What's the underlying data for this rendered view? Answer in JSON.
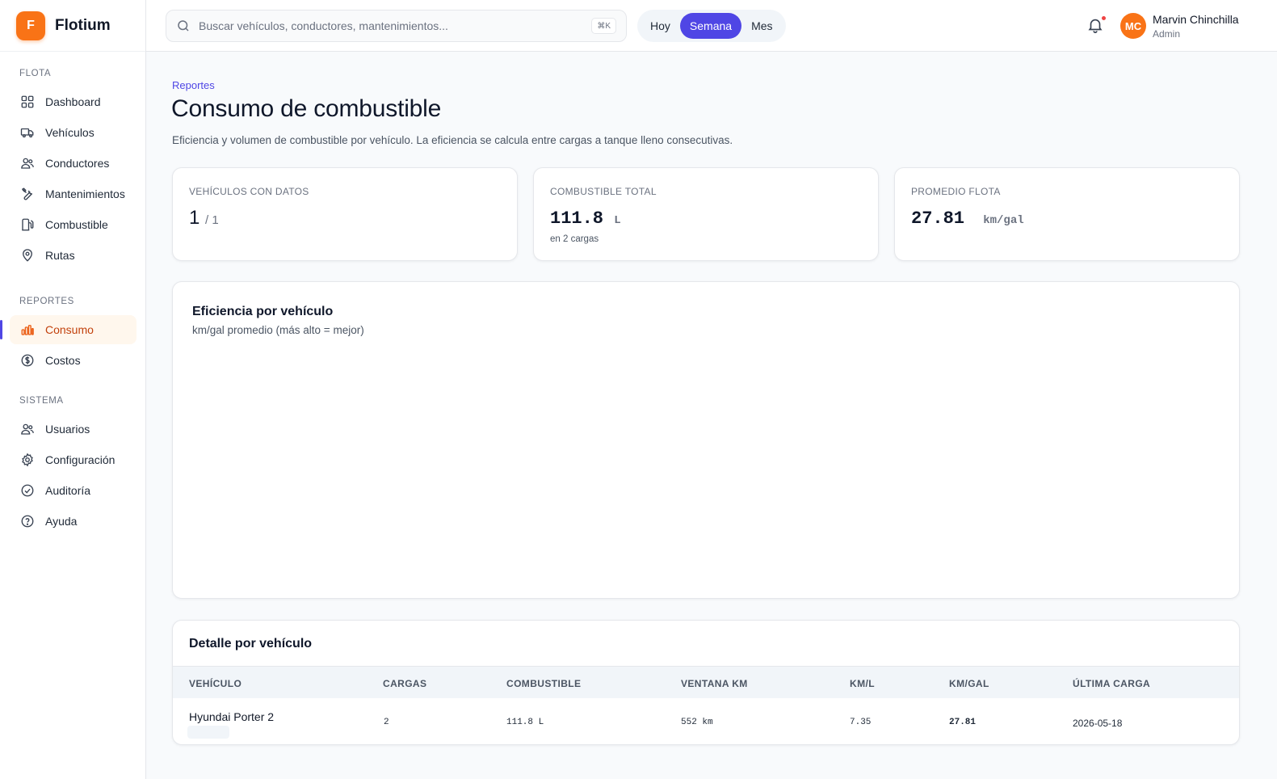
{
  "app": {
    "logo_letter": "F",
    "name": "Flotium"
  },
  "sidebar": {
    "sections": [
      {
        "label": "FLOTA",
        "items": [
          {
            "label": "Dashboard",
            "icon": "grid-icon"
          },
          {
            "label": "Vehículos",
            "icon": "truck-icon"
          },
          {
            "label": "Conductores",
            "icon": "users-icon"
          },
          {
            "label": "Mantenimientos",
            "icon": "wrench-icon"
          },
          {
            "label": "Combustible",
            "icon": "fuel-icon"
          },
          {
            "label": "Rutas",
            "icon": "map-pin-icon"
          }
        ]
      },
      {
        "label": "REPORTES",
        "items": [
          {
            "label": "Consumo",
            "icon": "bar-chart-icon",
            "active": true
          },
          {
            "label": "Costos",
            "icon": "dollar-circle-icon"
          }
        ]
      },
      {
        "label": "SISTEMA",
        "items": [
          {
            "label": "Usuarios",
            "icon": "users-icon"
          },
          {
            "label": "Configuración",
            "icon": "gear-icon"
          },
          {
            "label": "Auditoría",
            "icon": "check-circle-icon"
          },
          {
            "label": "Ayuda",
            "icon": "help-circle-icon"
          }
        ]
      }
    ]
  },
  "topbar": {
    "search_placeholder": "Buscar vehículos, conductores, mantenimientos...",
    "search_shortcut": "⌘K",
    "periods": [
      "Hoy",
      "Semana",
      "Mes"
    ],
    "active_period": "Semana",
    "user": {
      "initials": "MC",
      "name": "Marvin Chinchilla",
      "role": "Admin"
    }
  },
  "page": {
    "breadcrumb": "Reportes",
    "title": "Consumo de combustible",
    "subtitle": "Eficiencia y volumen de combustible por vehículo. La eficiencia se calcula entre cargas a tanque lleno consecutivas."
  },
  "stats": {
    "vehicles": {
      "label": "VEHÍCULOS CON DATOS",
      "value": "1",
      "total": "/ 1"
    },
    "fuel": {
      "label": "COMBUSTIBLE TOTAL",
      "value": "111.8",
      "unit": "L",
      "sub": "en 2 cargas"
    },
    "avg": {
      "label": "PROMEDIO FLOTA",
      "value": "27.81",
      "unit": "km/gal"
    }
  },
  "chart": {
    "title": "Eficiencia por vehículo",
    "subtitle": "km/gal promedio (más alto = mejor)"
  },
  "detail": {
    "title": "Detalle por vehículo",
    "columns": [
      "VEHÍCULO",
      "CARGAS",
      "COMBUSTIBLE",
      "VENTANA KM",
      "KM/L",
      "KM/GAL",
      "ÚLTIMA CARGA"
    ],
    "rows": [
      {
        "vehicle": "Hyundai Porter 2",
        "cargas": "2",
        "combustible": "111.8 L",
        "ventana_km": "552 km",
        "km_l": "7.35",
        "km_gal": "27.81",
        "ultima_carga": "2026-05-18"
      }
    ]
  },
  "colors": {
    "accent": "#4f46e5",
    "brand": "#f97316",
    "notification": "#ef4444"
  }
}
